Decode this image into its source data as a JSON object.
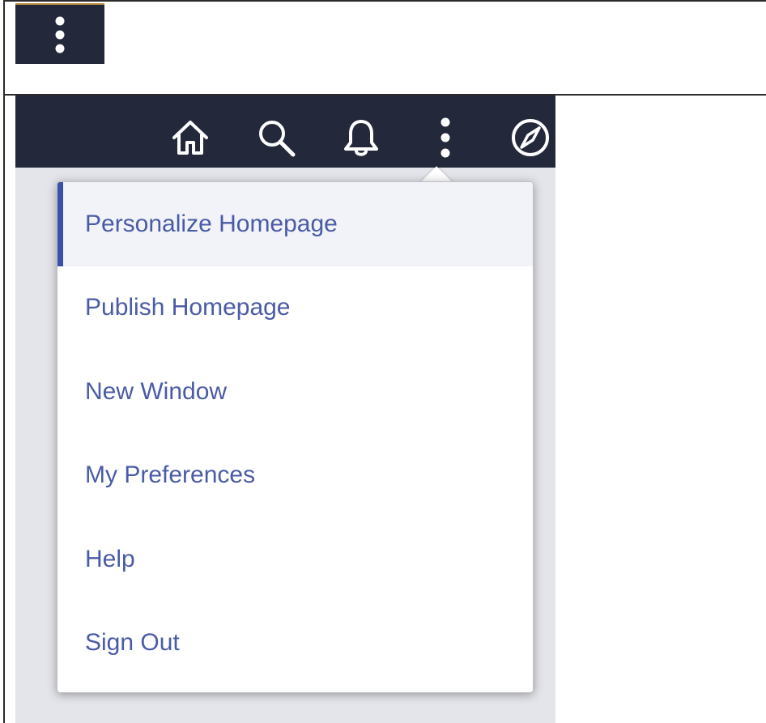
{
  "top_tile": {
    "icon": "vertical-ellipsis-icon"
  },
  "header": {
    "icons": [
      "home-icon",
      "search-icon",
      "bell-icon",
      "vertical-ellipsis-icon",
      "compass-icon"
    ]
  },
  "actions_menu": {
    "items": [
      {
        "label": "Personalize Homepage",
        "active": true
      },
      {
        "label": "Publish Homepage"
      },
      {
        "label": "New Window"
      },
      {
        "label": "My Preferences"
      },
      {
        "label": "Help"
      },
      {
        "label": "Sign Out"
      }
    ]
  },
  "colors": {
    "header_bg": "#23283a",
    "link": "#4a5ba6",
    "active_indicator": "#3b4eaa",
    "active_bg": "#f2f3f8"
  }
}
